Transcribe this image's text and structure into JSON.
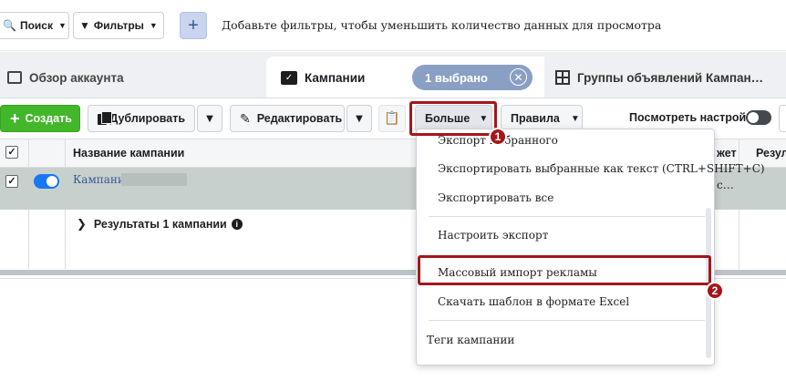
{
  "filter_bar": {
    "search_label": "Поиск",
    "filters_label": "Фильтры",
    "add_label": "+",
    "hint": "Добавьте фильтры, чтобы уменьшить количество данных для просмотра"
  },
  "tabs": {
    "overview": "Обзор аккаунта",
    "campaigns": "Кампании",
    "selected": "1 выбрано",
    "groups": "Группы объявлений Кампан…"
  },
  "toolbar": {
    "create": "Создать",
    "duplicate": "Дублировать",
    "edit": "Редактировать",
    "more": "Больше",
    "rules": "Правила",
    "view_settings": "Посмотреть настройки"
  },
  "table": {
    "columns": [
      "Название кампании",
      "жет",
      "Резул"
    ],
    "row": {
      "campaign_name": "Кампания_",
      "right_cell": "с…"
    },
    "results_label": "Результаты 1 кампании"
  },
  "menu": {
    "items": [
      "Экспорт выбранного",
      "Экспортировать выбранные как текст (CTRL+SHIFT+C)",
      "Экспортировать все",
      "Настроить экспорт",
      "Массовый импорт рекламы",
      "Скачать шаблон в формате Excel",
      "Теги кампании"
    ]
  },
  "callouts": {
    "first": "1",
    "second": "2"
  },
  "colors": {
    "highlight": "#a4161a",
    "create_green": "#42b72a",
    "toggle_blue": "#1877f2",
    "selected_row": "#c8d0cd"
  }
}
